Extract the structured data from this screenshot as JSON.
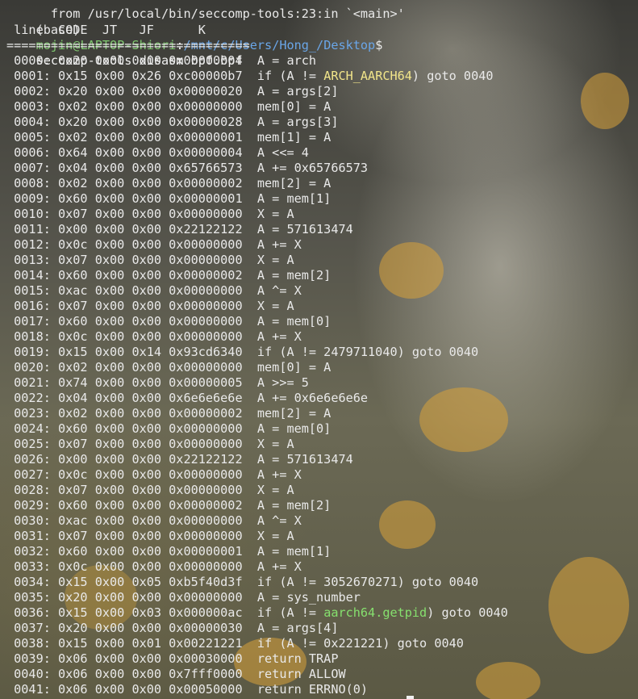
{
  "terminal": {
    "top_fragment": "  from /usr/local/bin/seccomp-tools:23:in `<main>'",
    "prompt": {
      "env": "(base)",
      "user_host": "mojin@LAPTOP-Shiori",
      "colon": ":",
      "path": "/mnt/c/Users/Hong_/Desktop",
      "dollar": "$",
      "command": "seccomp-tools disasm bpf.bpf"
    },
    "header": " line  CODE  JT   JF      K",
    "separator": "=================================",
    "rows": [
      {
        "text": " 0000: 0x20 0x00 0x00 0x00000004  A = arch"
      },
      {
        "pre": " 0001: 0x15 0x00 0x26 0xc00000b7  if (A != ",
        "hl": "ARCH_AARCH64",
        "post": ") goto 0040",
        "hlcolor": "arch"
      },
      {
        "text": " 0002: 0x20 0x00 0x00 0x00000020  A = args[2]"
      },
      {
        "text": " 0003: 0x02 0x00 0x00 0x00000000  mem[0] = A"
      },
      {
        "text": " 0004: 0x20 0x00 0x00 0x00000028  A = args[3]"
      },
      {
        "text": " 0005: 0x02 0x00 0x00 0x00000001  mem[1] = A"
      },
      {
        "text": " 0006: 0x64 0x00 0x00 0x00000004  A <<= 4"
      },
      {
        "text": " 0007: 0x04 0x00 0x00 0x65766573  A += 0x65766573"
      },
      {
        "text": " 0008: 0x02 0x00 0x00 0x00000002  mem[2] = A"
      },
      {
        "text": " 0009: 0x60 0x00 0x00 0x00000001  A = mem[1]"
      },
      {
        "text": " 0010: 0x07 0x00 0x00 0x00000000  X = A"
      },
      {
        "text": " 0011: 0x00 0x00 0x00 0x22122122  A = 571613474"
      },
      {
        "text": " 0012: 0x0c 0x00 0x00 0x00000000  A += X"
      },
      {
        "text": " 0013: 0x07 0x00 0x00 0x00000000  X = A"
      },
      {
        "text": " 0014: 0x60 0x00 0x00 0x00000002  A = mem[2]"
      },
      {
        "text": " 0015: 0xac 0x00 0x00 0x00000000  A ^= X"
      },
      {
        "text": " 0016: 0x07 0x00 0x00 0x00000000  X = A"
      },
      {
        "text": " 0017: 0x60 0x00 0x00 0x00000000  A = mem[0]"
      },
      {
        "text": " 0018: 0x0c 0x00 0x00 0x00000000  A += X"
      },
      {
        "text": " 0019: 0x15 0x00 0x14 0x93cd6340  if (A != 2479711040) goto 0040"
      },
      {
        "text": " 0020: 0x02 0x00 0x00 0x00000000  mem[0] = A"
      },
      {
        "text": " 0021: 0x74 0x00 0x00 0x00000005  A >>= 5"
      },
      {
        "text": " 0022: 0x04 0x00 0x00 0x6e6e6e6e  A += 0x6e6e6e6e"
      },
      {
        "text": " 0023: 0x02 0x00 0x00 0x00000002  mem[2] = A"
      },
      {
        "text": " 0024: 0x60 0x00 0x00 0x00000000  A = mem[0]"
      },
      {
        "text": " 0025: 0x07 0x00 0x00 0x00000000  X = A"
      },
      {
        "text": " 0026: 0x00 0x00 0x00 0x22122122  A = 571613474"
      },
      {
        "text": " 0027: 0x0c 0x00 0x00 0x00000000  A += X"
      },
      {
        "text": " 0028: 0x07 0x00 0x00 0x00000000  X = A"
      },
      {
        "text": " 0029: 0x60 0x00 0x00 0x00000002  A = mem[2]"
      },
      {
        "text": " 0030: 0xac 0x00 0x00 0x00000000  A ^= X"
      },
      {
        "text": " 0031: 0x07 0x00 0x00 0x00000000  X = A"
      },
      {
        "text": " 0032: 0x60 0x00 0x00 0x00000001  A = mem[1]"
      },
      {
        "text": " 0033: 0x0c 0x00 0x00 0x00000000  A += X"
      },
      {
        "text": " 0034: 0x15 0x00 0x05 0xb5f40d3f  if (A != 3052670271) goto 0040"
      },
      {
        "text": " 0035: 0x20 0x00 0x00 0x00000000  A = sys_number"
      },
      {
        "pre": " 0036: 0x15 0x00 0x03 0x000000ac  if (A != ",
        "hl": "aarch64.getpid",
        "post": ") goto 0040",
        "hlcolor": "sys"
      },
      {
        "text": " 0037: 0x20 0x00 0x00 0x00000030  A = args[4]"
      },
      {
        "text": " 0038: 0x15 0x00 0x01 0x00221221  if (A != 0x221221) goto 0040"
      },
      {
        "text": " 0039: 0x06 0x00 0x00 0x00030000  return TRAP"
      },
      {
        "text": " 0040: 0x06 0x00 0x00 0x7fff0000  return ALLOW"
      },
      {
        "text": " 0041: 0x06 0x00 0x00 0x00050000  return ERRNO(0)"
      }
    ]
  },
  "colors": {
    "prompt_user": "#7fc76f",
    "prompt_path": "#6aa6e8",
    "arch_highlight": "#f1e58a",
    "syscall_highlight": "#86e06e"
  }
}
